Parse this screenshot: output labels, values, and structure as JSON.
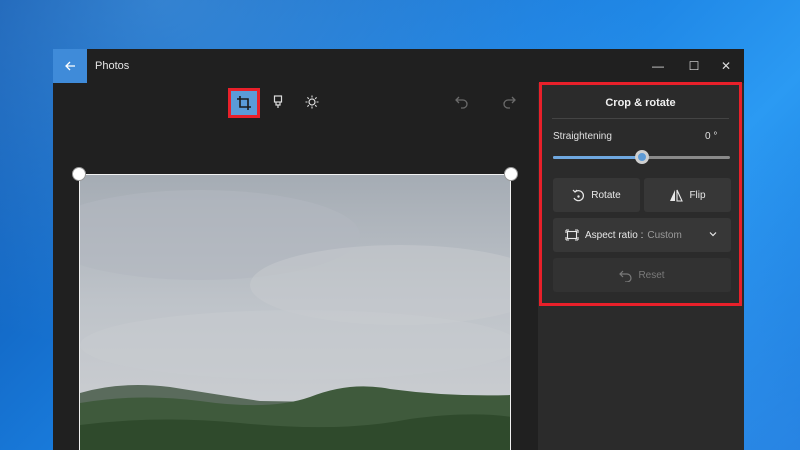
{
  "window": {
    "app_title": "Photos",
    "controls": {
      "minimize": "—",
      "maximize": "☐",
      "close": "✕"
    }
  },
  "toolbar": {
    "crop_icon": "crop-icon",
    "markup_icon": "markup-icon",
    "adjust_icon": "brightness-icon",
    "undo_icon": "undo-icon",
    "redo_icon": "redo-icon"
  },
  "panel": {
    "title": "Crop & rotate",
    "straightening_label": "Straightening",
    "straightening_value": "0 °",
    "straightening_level": 0.5,
    "rotate_label": "Rotate",
    "flip_label": "Flip",
    "aspect_label": "Aspect ratio :",
    "aspect_value": "Custom",
    "reset_label": "Reset"
  },
  "colors": {
    "accent": "#3f8bd9",
    "highlight": "#e8202a"
  }
}
